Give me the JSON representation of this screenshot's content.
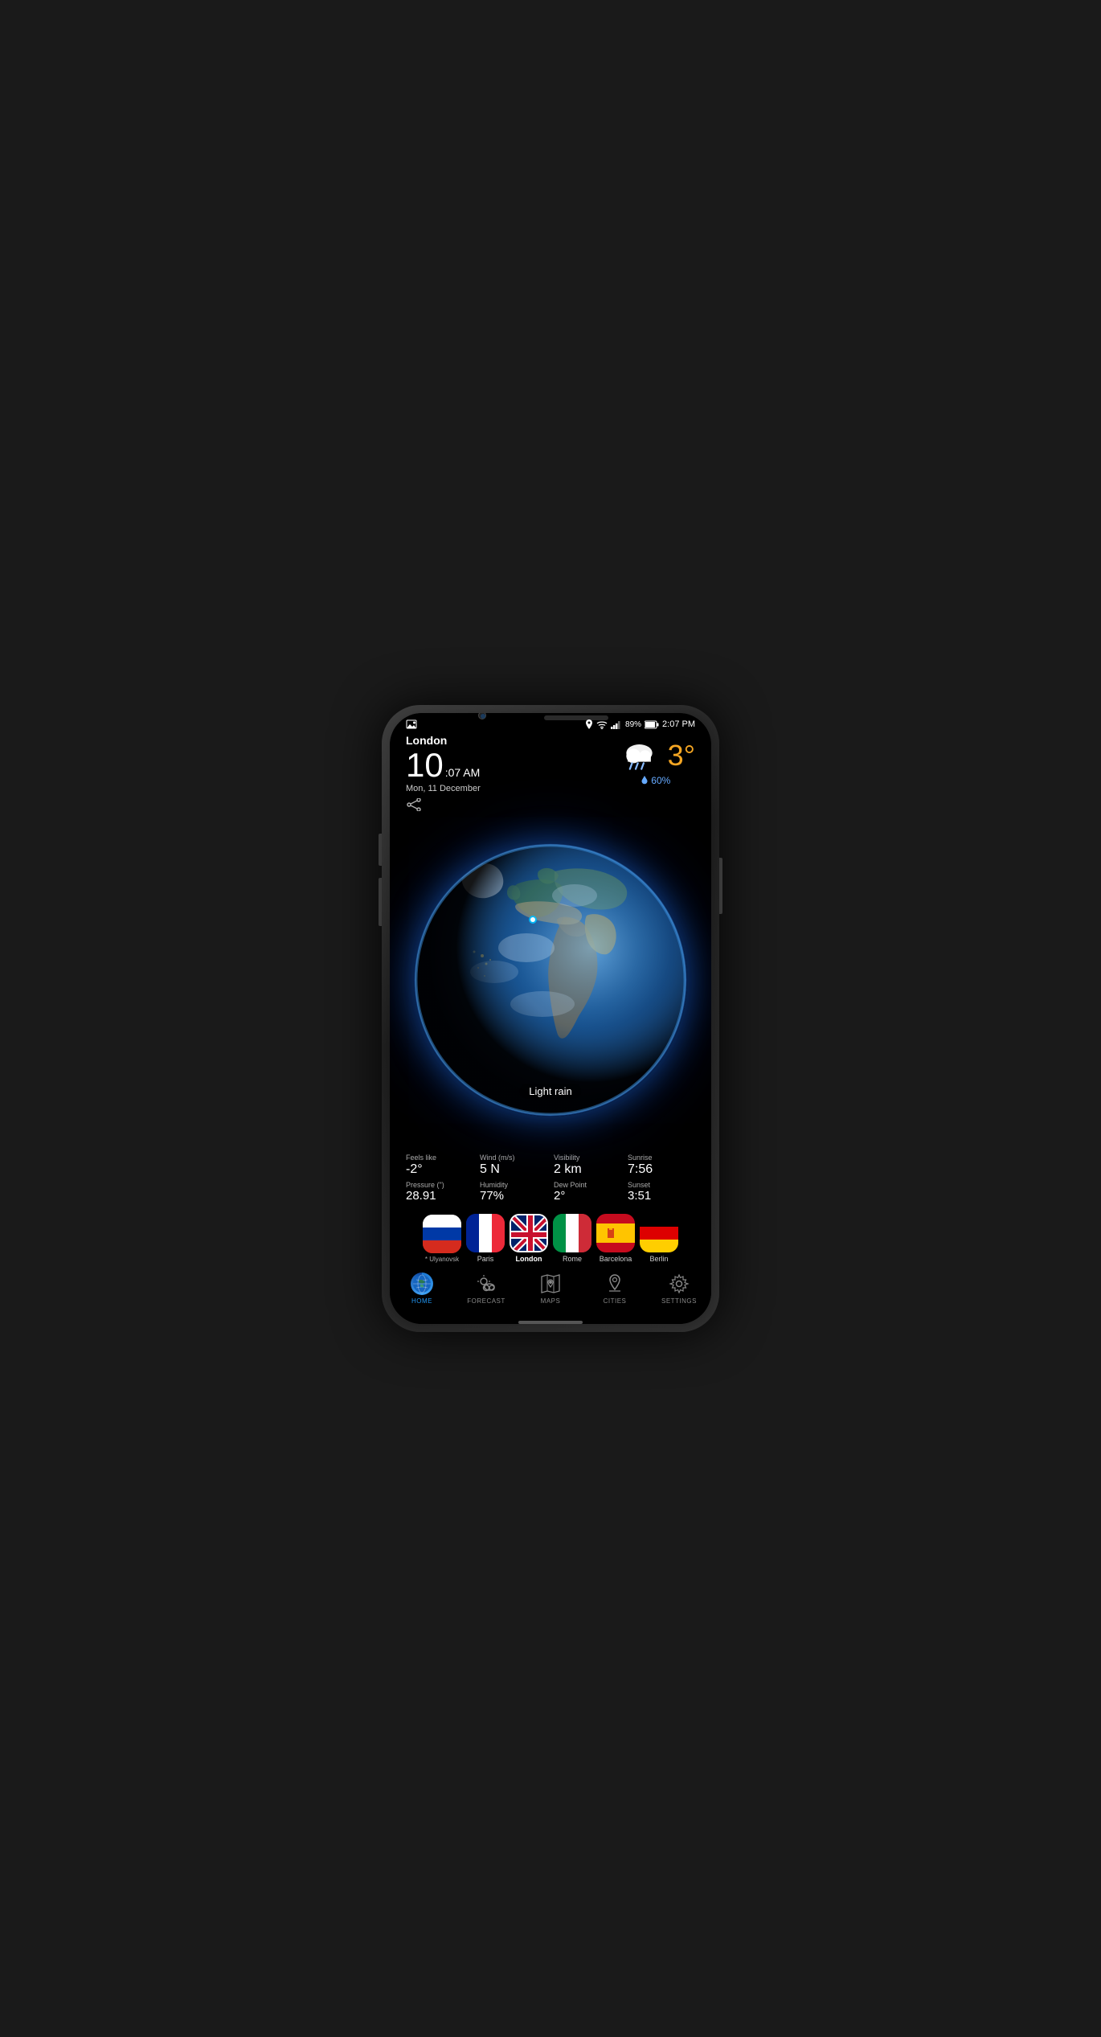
{
  "phone": {
    "status_bar": {
      "location_icon": "📍",
      "wifi_icon": "wifi",
      "signal_icon": "signal",
      "battery": "89%",
      "time": "2:07 PM"
    },
    "weather": {
      "city": "London",
      "time_big": "10",
      "time_small": ":07 AM",
      "date": "Mon, 11 December",
      "temperature": "3°",
      "precipitation": "60%",
      "condition": "Light rain",
      "feels_like_label": "Feels like",
      "feels_like_value": "-2°",
      "wind_label": "Wind (m/s)",
      "wind_value": "5 N",
      "visibility_label": "Visibility",
      "visibility_value": "2 km",
      "sunrise_label": "Sunrise",
      "sunrise_value": "7:56",
      "pressure_label": "Pressure (\")",
      "pressure_value": "28.91",
      "humidity_label": "Humidity",
      "humidity_value": "77%",
      "dew_point_label": "Dew Point",
      "dew_point_value": "2°",
      "sunset_label": "Sunset",
      "sunset_value": "3:51"
    },
    "cities": [
      {
        "name": "* Ulyanovsk",
        "flag": "ru",
        "active": false
      },
      {
        "name": "Paris",
        "flag": "fr",
        "active": false
      },
      {
        "name": "London",
        "flag": "gb",
        "active": true
      },
      {
        "name": "Rome",
        "flag": "it",
        "active": false
      },
      {
        "name": "Barcelona",
        "flag": "es",
        "active": false
      },
      {
        "name": "Berlin",
        "flag": "de",
        "active": false
      }
    ],
    "nav": [
      {
        "id": "home",
        "label": "HOME",
        "active": true
      },
      {
        "id": "forecast",
        "label": "FORECAST",
        "active": false
      },
      {
        "id": "maps",
        "label": "MAPS",
        "active": false
      },
      {
        "id": "cities",
        "label": "CITIES",
        "active": false
      },
      {
        "id": "settings",
        "label": "SETTINGS",
        "active": false
      }
    ]
  }
}
